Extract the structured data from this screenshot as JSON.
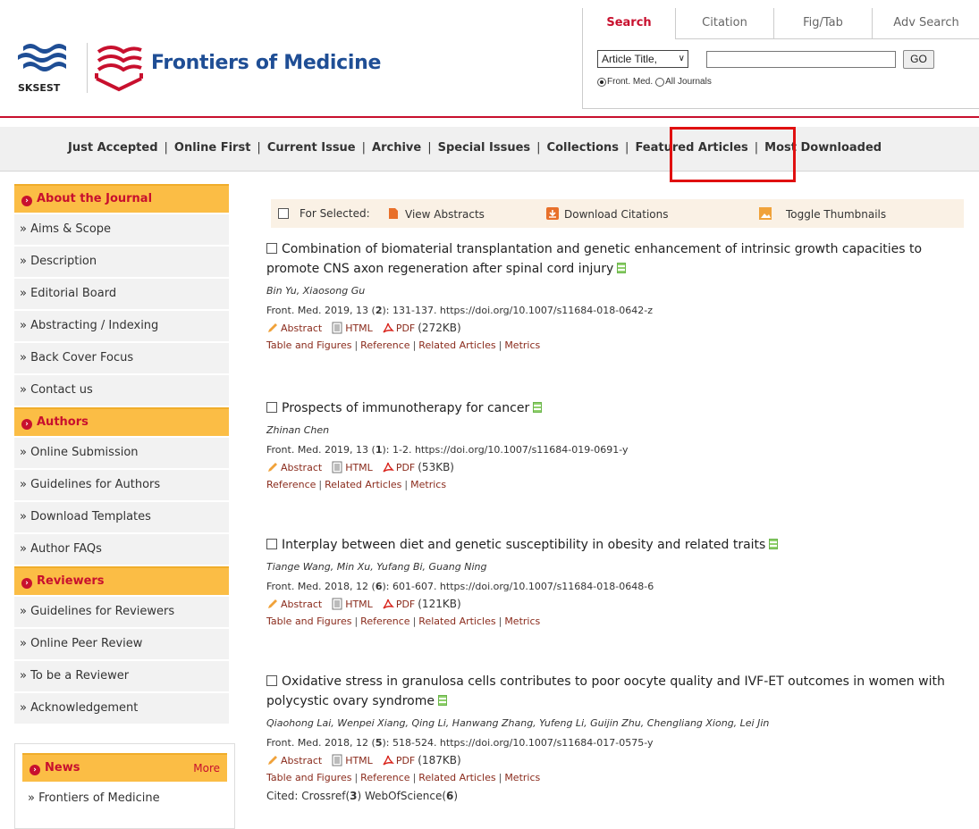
{
  "brand": {
    "logo_text": "SKSEST",
    "title": "Frontiers of Medicine"
  },
  "search": {
    "tabs": [
      "Search",
      "Citation",
      "Fig/Tab",
      "Adv Search"
    ],
    "field_select": "Article Title,",
    "go_label": "GO",
    "radio_journal": "Front. Med.",
    "radio_all": "All Journals"
  },
  "nav": {
    "items": [
      "Just Accepted",
      "Online First",
      "Current Issue",
      "Archive",
      "Special Issues",
      "Collections",
      "Featured Articles",
      "Most Downloaded"
    ]
  },
  "sidebar": {
    "about": {
      "heading": "About the Journal",
      "items": [
        "» Aims & Scope",
        "» Description",
        "» Editorial Board",
        "» Abstracting / Indexing",
        "» Back Cover Focus",
        "» Contact us"
      ]
    },
    "authors": {
      "heading": "Authors",
      "items": [
        "» Online Submission",
        "» Guidelines for Authors",
        "» Download Templates",
        "» Author FAQs"
      ]
    },
    "reviewers": {
      "heading": "Reviewers",
      "items": [
        "» Guidelines for Reviewers",
        "» Online Peer Review",
        "» To be a Reviewer",
        "» Acknowledgement"
      ]
    },
    "news": {
      "heading": "News",
      "more": "More",
      "items": [
        "» Frontiers of Medicine"
      ]
    }
  },
  "toolbar": {
    "for_selected": "For Selected:",
    "view_abstracts": "View Abstracts",
    "download_citations": "Download Citations",
    "toggle_thumbnails": "Toggle Thumbnails"
  },
  "links": {
    "abstract": "Abstract",
    "html": "HTML",
    "pdf": "PDF"
  },
  "articles": [
    {
      "title": "Combination of biomaterial transplantation and genetic enhancement of intrinsic growth capacities to promote CNS axon regeneration after spinal cord injury",
      "authors": "Bin Yu, Xiaosong Gu",
      "cite_pre": "Front. Med.   2019, 13 (",
      "issue": "2",
      "cite_post": "): 131-137.   https://doi.org/10.1007/s11684-018-0642-z",
      "pdf_size": "(272KB)",
      "meta": [
        "Table and Figures",
        "Reference",
        "Related Articles",
        "Metrics"
      ]
    },
    {
      "title": "Prospects of immunotherapy for cancer",
      "authors": "Zhinan Chen",
      "cite_pre": "Front. Med.   2019, 13 (",
      "issue": "1",
      "cite_post": "): 1-2.   https://doi.org/10.1007/s11684-019-0691-y",
      "pdf_size": "(53KB)",
      "meta": [
        "Reference",
        "Related Articles",
        "Metrics"
      ]
    },
    {
      "title": "Interplay between diet and genetic susceptibility in obesity and related traits",
      "authors": "Tiange Wang, Min Xu, Yufang Bi, Guang Ning",
      "cite_pre": "Front. Med.   2018, 12 (",
      "issue": "6",
      "cite_post": "): 601-607.   https://doi.org/10.1007/s11684-018-0648-6",
      "pdf_size": "(121KB)",
      "meta": [
        "Table and Figures",
        "Reference",
        "Related Articles",
        "Metrics"
      ]
    },
    {
      "title": "Oxidative stress in granulosa cells contributes to poor oocyte quality and IVF-ET outcomes in women with polycystic ovary syndrome",
      "authors": "Qiaohong Lai, Wenpei Xiang, Qing Li, Hanwang Zhang, Yufeng Li, Guijin Zhu, Chengliang Xiong, Lei Jin",
      "cite_pre": "Front. Med.   2018, 12 (",
      "issue": "5",
      "cite_post": "): 518-524.   https://doi.org/10.1007/s11684-017-0575-y",
      "pdf_size": "(187KB)",
      "meta": [
        "Table and Figures",
        "Reference",
        "Related Articles",
        "Metrics"
      ],
      "cited_label": "Cited: Crossref(",
      "crossref": "3",
      "wos_label": ") WebOfScience(",
      "wos": "6",
      "cited_end": ")"
    }
  ],
  "colors": {
    "brand_blue": "#1f4e95",
    "accent_red": "#c8102e",
    "sidebar_head": "#fbbd45",
    "link_brown": "#8a2b1c",
    "highlight": "#e01010"
  }
}
